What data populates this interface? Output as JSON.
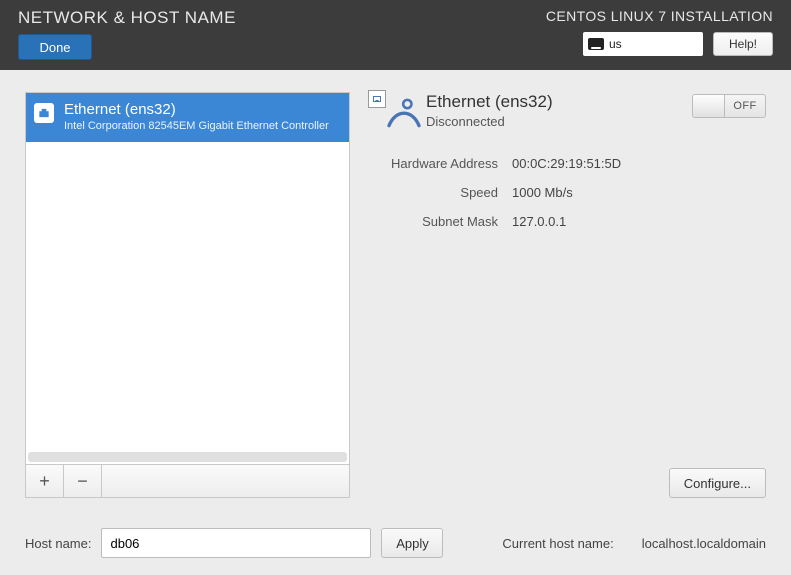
{
  "header": {
    "title": "NETWORK & HOST NAME",
    "done_label": "Done",
    "installer_title": "CENTOS LINUX 7 INSTALLATION",
    "keyboard_layout": "us",
    "help_label": "Help!"
  },
  "nic_list": {
    "items": [
      {
        "name": "Ethernet (ens32)",
        "description": "Intel Corporation 82545EM Gigabit Ethernet Controller"
      }
    ],
    "add_label": "+",
    "remove_label": "−"
  },
  "interface": {
    "title": "Ethernet (ens32)",
    "status": "Disconnected",
    "toggle_label": "OFF",
    "details": {
      "hw_addr_label": "Hardware Address",
      "hw_addr_value": "00:0C:29:19:51:5D",
      "speed_label": "Speed",
      "speed_value": "1000 Mb/s",
      "subnet_label": "Subnet Mask",
      "subnet_value": "127.0.0.1"
    },
    "configure_label": "Configure..."
  },
  "hostname": {
    "label": "Host name:",
    "value": "db06",
    "apply_label": "Apply",
    "current_label": "Current host name:",
    "current_value": "localhost.localdomain"
  }
}
